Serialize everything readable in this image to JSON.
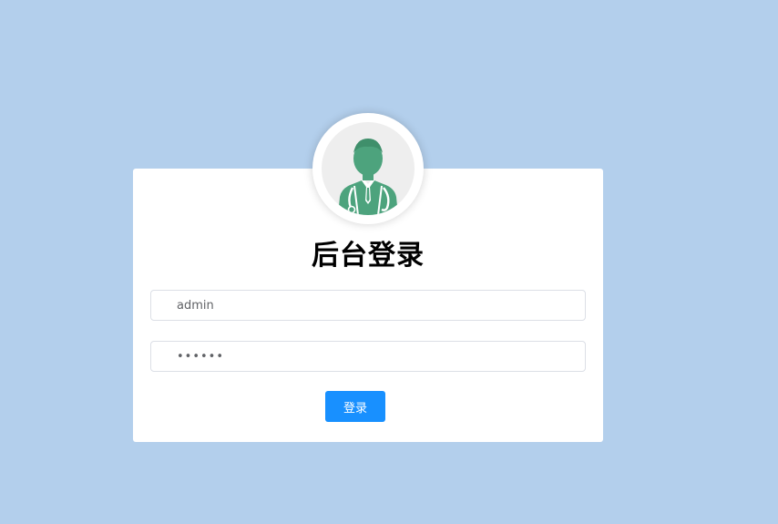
{
  "login": {
    "title": "后台登录",
    "username_value": "admin",
    "password_value": "123456",
    "submit_label": "登录"
  },
  "avatar": {
    "icon": "doctor-avatar-icon"
  },
  "colors": {
    "background": "#b3cfec",
    "card": "#ffffff",
    "accent": "#1890ff",
    "avatar_green": "#4da37d"
  }
}
